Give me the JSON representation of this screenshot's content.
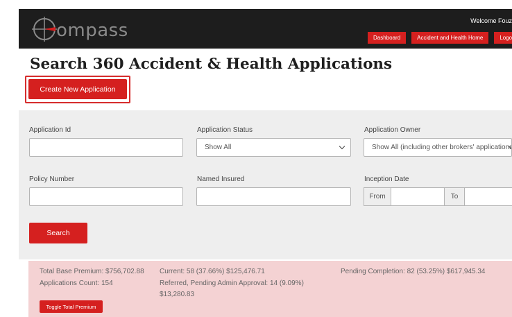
{
  "header": {
    "logo_text": "ompass",
    "welcome": "Welcome Fouz",
    "nav": [
      "Dashboard",
      "Accident and Health Home",
      "Logout"
    ]
  },
  "page": {
    "title": "Search 360 Accident & Health Applications",
    "create_button": "Create New Application"
  },
  "filters": {
    "application_id": {
      "label": "Application Id",
      "value": ""
    },
    "application_status": {
      "label": "Application Status",
      "value": "Show All"
    },
    "application_owner": {
      "label": "Application Owner",
      "value": "Show All (including other brokers' applications"
    },
    "policy_number": {
      "label": "Policy Number",
      "value": ""
    },
    "named_insured": {
      "label": "Named Insured",
      "value": ""
    },
    "inception_date": {
      "label": "Inception Date",
      "from_label": "From",
      "to_label": "To",
      "from_value": "",
      "to_value": ""
    },
    "search_button": "Search"
  },
  "summary": {
    "total_base_premium": "Total Base Premium: $756,702.88",
    "applications_count": "Applications Count: 154",
    "current": "Current: 58 (37.66%) $125,476.71",
    "referred_line1": "Referred, Pending Admin Approval: 14 (9.09%)",
    "referred_line2": "$13,280.83",
    "pending_completion": "Pending Completion: 82 (53.25%) $617,945.34",
    "toggle_button": "Toggle Total Premium"
  },
  "colors": {
    "accent": "#d5201f",
    "header_bg": "#1d1d1d",
    "panel_bg": "#eeeeee",
    "summary_bg": "#f4d2d3"
  }
}
